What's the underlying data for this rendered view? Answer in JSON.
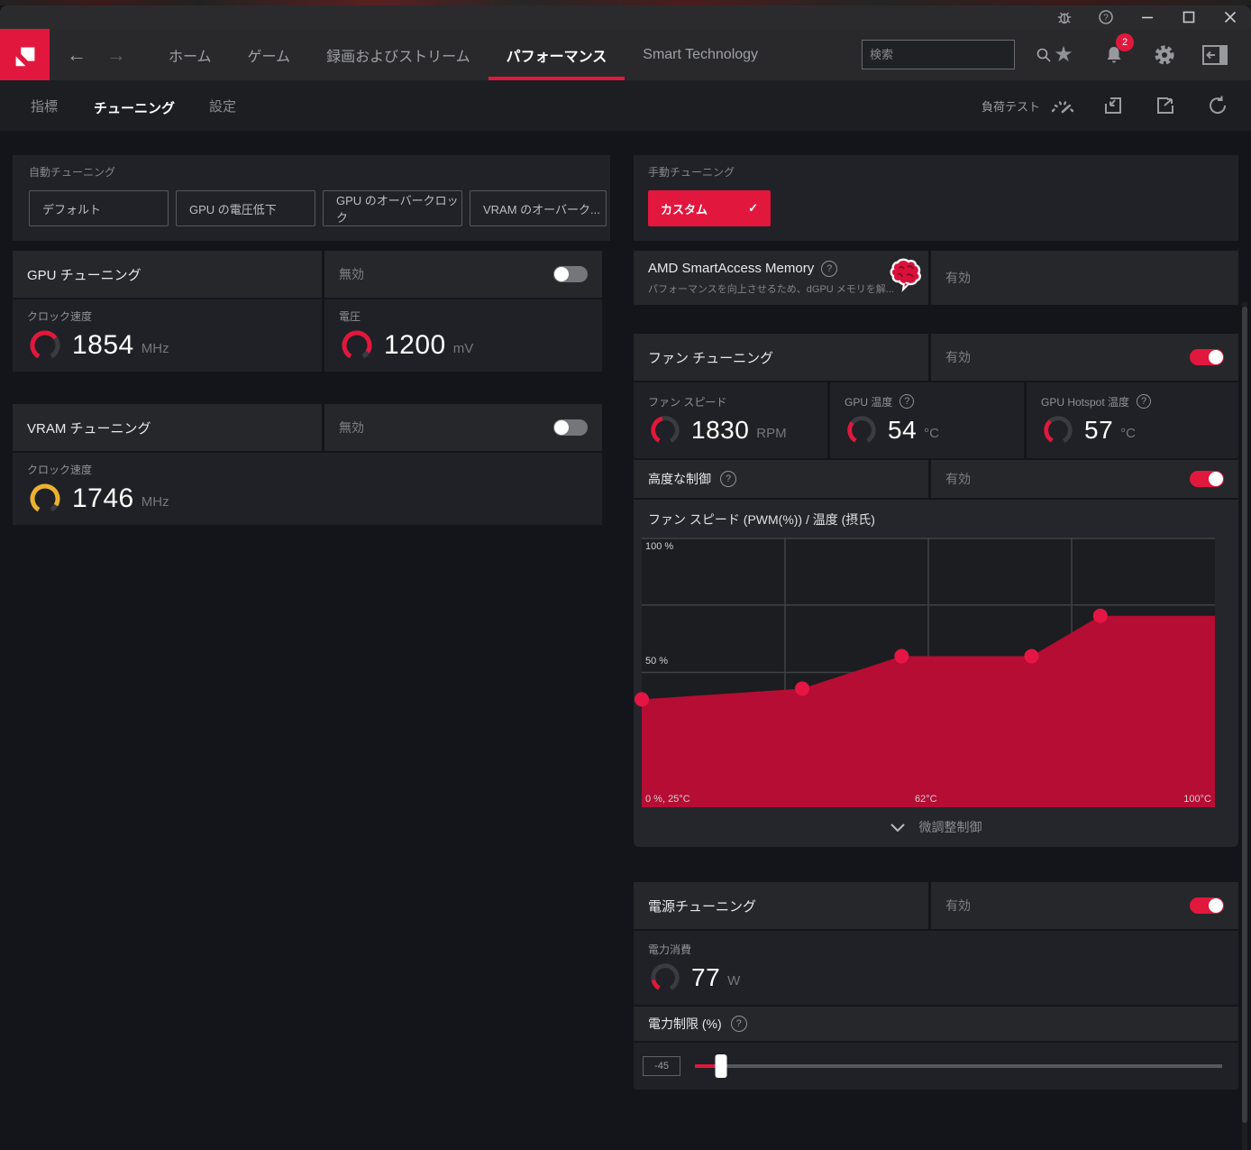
{
  "colors": {
    "accent": "#e2173d",
    "chart_fill": "#b50d34",
    "chart_point": "#e51643",
    "vram_gauge": "#ecb22f",
    "toggle_off": "#74767a"
  },
  "navbar": {
    "back_glyph": "←",
    "forward_glyph": "→",
    "items": [
      {
        "label": "ホーム",
        "active": false
      },
      {
        "label": "ゲーム",
        "active": false
      },
      {
        "label": "録画およびストリーム",
        "active": false
      },
      {
        "label": "パフォーマンス",
        "active": true
      },
      {
        "label": "Smart Technology",
        "active": false
      }
    ],
    "search": {
      "placeholder": "検索"
    },
    "notification_count": "2"
  },
  "subnav": {
    "tabs": [
      {
        "label": "指標",
        "active": false
      },
      {
        "label": "チューニング",
        "active": true
      },
      {
        "label": "設定",
        "active": false
      }
    ],
    "stress_test_label": "負荷テスト"
  },
  "auto_tuning": {
    "title": "自動チューニング",
    "buttons": [
      "デフォルト",
      "GPU の電圧低下",
      "GPU のオーバークロック",
      "VRAM のオーバーク..."
    ]
  },
  "manual_tuning": {
    "title": "手動チューニング",
    "custom_label": "カスタム",
    "check_glyph": "✓"
  },
  "gpu_tuning": {
    "title": "GPU チューニング",
    "state_label": "無効",
    "enabled": false,
    "clock": {
      "label": "クロック速度",
      "value": "1854",
      "unit": "MHz",
      "gauge_fraction": 0.68,
      "gauge_color": "#e2173d"
    },
    "voltage": {
      "label": "電圧",
      "value": "1200",
      "unit": "mV",
      "gauge_fraction": 0.9,
      "gauge_color": "#e2173d"
    }
  },
  "vram_tuning": {
    "title": "VRAM チューニング",
    "state_label": "無効",
    "enabled": false,
    "clock": {
      "label": "クロック速度",
      "value": "1746",
      "unit": "MHz",
      "gauge_fraction": 0.9,
      "gauge_color": "#ecb22f"
    }
  },
  "smart_access": {
    "title": "AMD SmartAccess Memory",
    "subtitle": "パフォーマンスを向上させるため、dGPU メモリを解...",
    "state_label": "有効"
  },
  "fan_tuning": {
    "title": "ファン チューニング",
    "state_label": "有効",
    "enabled": true,
    "stats": [
      {
        "label": "ファン スピード",
        "value": "1830",
        "unit": "RPM",
        "gauge_fraction": 0.45,
        "gauge_color": "#e2173d"
      },
      {
        "label": "GPU 温度",
        "value": "54",
        "unit": "°C",
        "gauge_fraction": 0.33,
        "gauge_color": "#e2173d"
      },
      {
        "label": "GPU Hotspot 温度",
        "value": "57",
        "unit": "°C",
        "gauge_fraction": 0.36,
        "gauge_color": "#e2173d"
      }
    ],
    "advanced": {
      "label": "高度な制御",
      "state_label": "有効",
      "enabled": true
    },
    "chart_title": "ファン スピード (PWM(%)) / 温度 (摂氏)",
    "chart_data": {
      "type": "area",
      "x": [
        25,
        46,
        59,
        76,
        85
      ],
      "y": [
        40,
        44,
        56,
        56,
        71
      ],
      "xlim": [
        25,
        100
      ],
      "ylim": [
        0,
        100
      ],
      "xlabel": "温度 (摂氏)",
      "ylabel": "ファン スピード (PWM(%))",
      "extend_to_x_max": true,
      "grid": true,
      "tick_labels": {
        "top_left": "100 %",
        "mid_left": "50 %",
        "bottom_left": "0 %, 25°C",
        "bottom_center": "62°C",
        "bottom_right": "100°C"
      }
    },
    "fine_tune_label": "微調整制御"
  },
  "power_tuning": {
    "title": "電源チューニング",
    "state_label": "有効",
    "enabled": true,
    "consumption": {
      "label": "電力消費",
      "value": "77",
      "unit": "W",
      "gauge_fraction": 0.16,
      "gauge_color": "#e2173d"
    },
    "limit": {
      "label": "電力制限 (%)",
      "display": "-45",
      "value": -45,
      "min": -50,
      "max": 50
    }
  }
}
